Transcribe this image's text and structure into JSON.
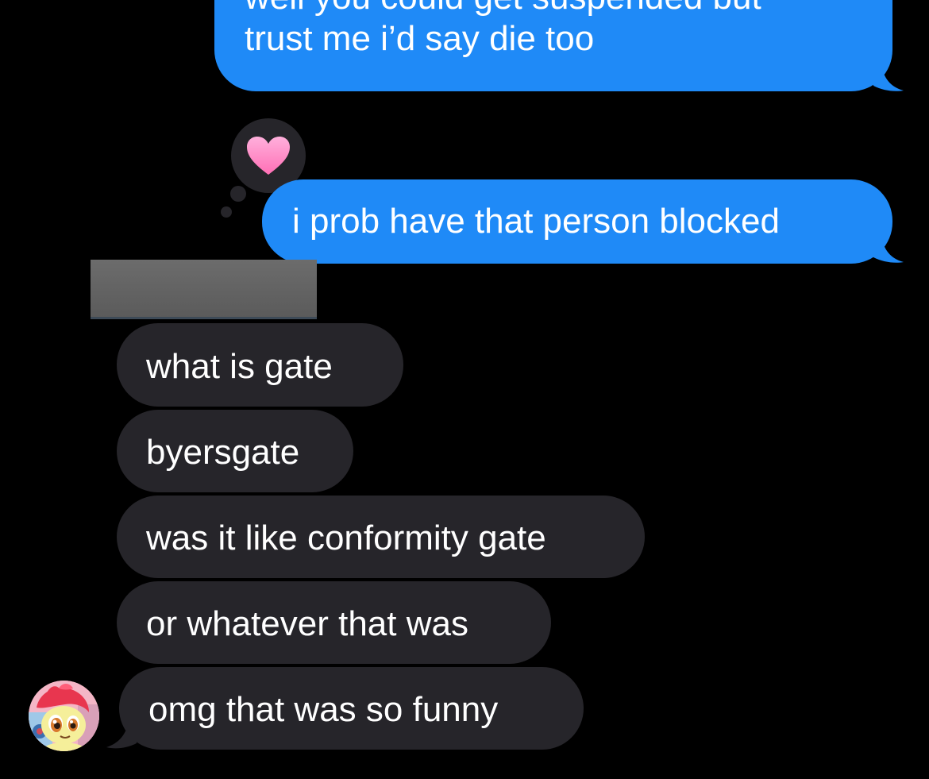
{
  "conversation": {
    "outgoing": [
      {
        "lines": [
          "well you could get suspended but",
          "trust me i’d say die too"
        ]
      },
      {
        "text": "i prob have that person blocked"
      }
    ],
    "incoming": [
      {
        "text": "what is gate"
      },
      {
        "text": "byersgate"
      },
      {
        "text": "was it like conformity gate"
      },
      {
        "text": "or whatever that was"
      },
      {
        "text": "omg that was so funny"
      }
    ],
    "tapback": {
      "icon": "heart-icon",
      "color": "#ff8fc8"
    },
    "sender_avatar": {
      "icon": "pony-avatar-icon"
    },
    "redacted_name": {
      "color": "#666666"
    }
  },
  "colors": {
    "background": "#000000",
    "outgoing_bubble": "#1f8af7",
    "incoming_bubble": "#26252a",
    "text": "#ffffff"
  }
}
